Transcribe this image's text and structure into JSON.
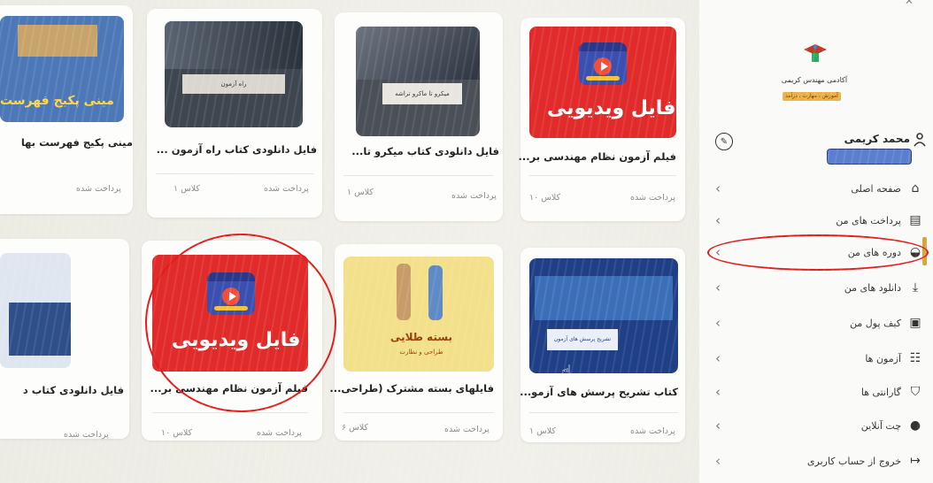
{
  "header": {
    "close_icon": "close-icon"
  },
  "brand": {
    "name": "آکادمی مهندس کریمی",
    "tagline": "آموزش ، مهارت ، درآمد"
  },
  "profile": {
    "name": "محمد کریمی",
    "icon": "user-icon",
    "edit_icon": "edit-icon"
  },
  "sidebar": {
    "items": [
      {
        "label": "صفحه اصلی",
        "icon": "home-icon"
      },
      {
        "label": "پرداخت های من",
        "icon": "wallet-icon"
      },
      {
        "label": "دوره های من",
        "icon": "courses-icon",
        "active": true
      },
      {
        "label": "دانلود های من",
        "icon": "download-icon"
      },
      {
        "label": "کیف پول من",
        "icon": "purse-icon"
      },
      {
        "label": "آزمون ها",
        "icon": "exam-icon"
      },
      {
        "label": "گارانتی ها",
        "icon": "shield-icon"
      },
      {
        "label": "چت آنلاین",
        "icon": "chat-icon"
      },
      {
        "label": "خروج از حساب کاربری",
        "icon": "logout-icon"
      }
    ]
  },
  "cards": [
    {
      "title": "فیلم آزمون نظام مهندسی بر...",
      "status": "پرداخت شده",
      "classes": "۱۰ کلاس",
      "thumb_text": "فایل ویدیویی"
    },
    {
      "title": "فایل دانلودی کتاب میکرو تا...",
      "status": "پرداخت شده",
      "classes": "۱ کلاس",
      "thumb_text": "میکرو تا ماکرو تراشه"
    },
    {
      "title": "فایل دانلودی کتاب راه آزمون ...",
      "status": "پرداخت شده",
      "classes": "۱ کلاس",
      "thumb_text": "راه آزمون"
    },
    {
      "title": "مینی پکیج فهرست بها",
      "status": "پرداخت شده",
      "classes": "",
      "thumb_text": "مینی پکیج فهرست"
    },
    {
      "title": "کتاب تشریح پرسش های آزمو...",
      "status": "پرداخت شده",
      "classes": "۱ کلاس",
      "thumb_text": "تشریح پرسش های آزمون"
    },
    {
      "title": "فایلهای بسته مشترک (طراحی...",
      "status": "پرداخت شده",
      "classes": "۶ کلاس",
      "thumb_text": "بسته طلایی",
      "thumb_sub": "طراحی و نظارت"
    },
    {
      "title": "فیلم آزمون نظام مهندسی بر...",
      "status": "پرداخت شده",
      "classes": "۱۰ کلاس",
      "thumb_text": "فایل ویدیویی"
    },
    {
      "title": "فایل دانلودی کتاب د",
      "status": "پرداخت شده",
      "classes": "",
      "thumb_text": ""
    }
  ],
  "colors": {
    "video_red": "#e12a2a",
    "annotation_red": "#e21b1b",
    "accent_gold": "#d4a63a",
    "gold_package": "#f3e08a"
  }
}
